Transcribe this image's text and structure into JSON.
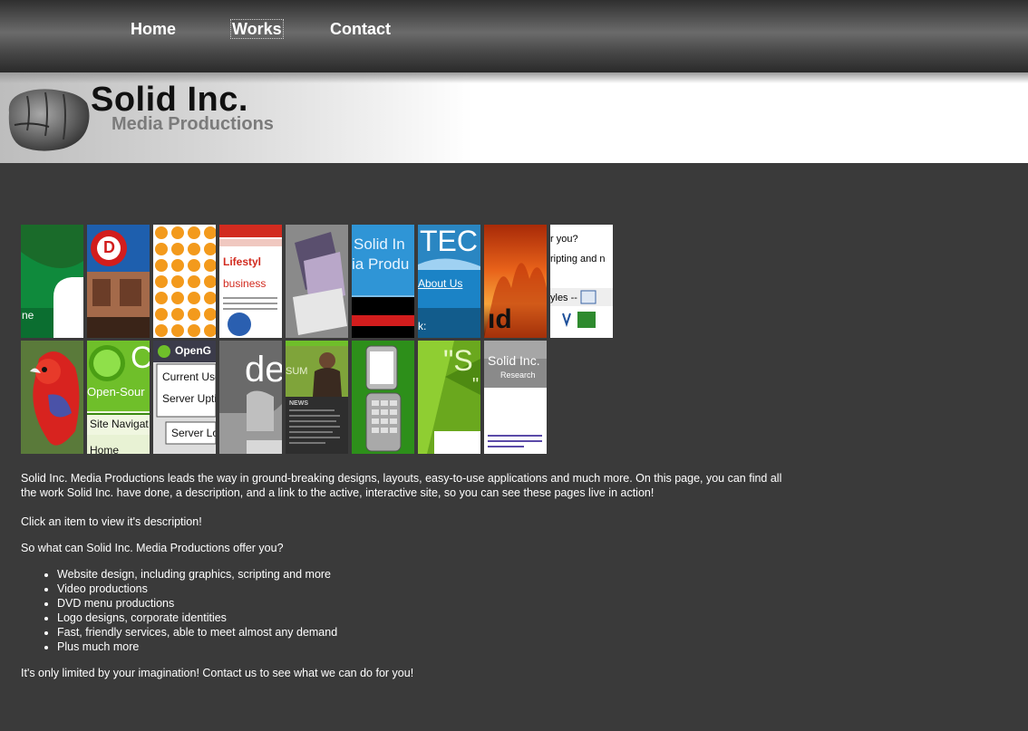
{
  "nav": {
    "items": [
      {
        "label": "Home"
      },
      {
        "label": "Works"
      },
      {
        "label": "Contact"
      }
    ]
  },
  "banner": {
    "title": "Solid Inc.",
    "subtitle": "Media Productions",
    "fist_icon": "fist-icon"
  },
  "thumbnails": {
    "row1": [
      {
        "text": "ne"
      },
      {
        "text": "D"
      },
      {
        "text": ""
      },
      {
        "text": "Lifestyl",
        "text2": "business"
      },
      {
        "text": ""
      },
      {
        "text": "Solid In",
        "text2": "ia Produ"
      },
      {
        "text": "TEC",
        "text2": "About Us",
        "text3": "k:"
      },
      {
        "text": "ıd"
      },
      {
        "text": "r you?",
        "text2": "ripting and n",
        "text3": "yles --"
      }
    ],
    "row2": [
      {
        "text": ""
      },
      {
        "text": "Open-Sour",
        "text2": "Site Navigat",
        "text3": "Home"
      },
      {
        "text": "OpenG",
        "text2": "Current Use",
        "text3": "Server Uptin",
        "text4": "Server Lo"
      },
      {
        "text": "de"
      },
      {
        "text": "SUM",
        "text2": "NEWS"
      },
      {
        "text": ""
      },
      {
        "text": "\"S"
      },
      {
        "text": "Solid Inc.",
        "text2": "Research"
      }
    ]
  },
  "content": {
    "intro": "Solid Inc. Media Productions leads the way in ground-breaking designs, layouts, easy-to-use applications and much more. On this page, you can find all the work Solid Inc. have done, a description, and a link to the active, interactive site, so you can see these pages live in action!",
    "click_hint": "Click an item to view it's description!",
    "offer_question": "So what can Solid Inc. Media Productions offer you?",
    "services": [
      "Website design, including graphics, scripting and more",
      "Video productions",
      "DVD menu productions",
      "Logo designs, corporate identities",
      "Fast, friendly services, able to meet almost any demand",
      "Plus much more"
    ],
    "closing": "It's only limited by your imagination! Contact us to see what we can do for you!"
  }
}
